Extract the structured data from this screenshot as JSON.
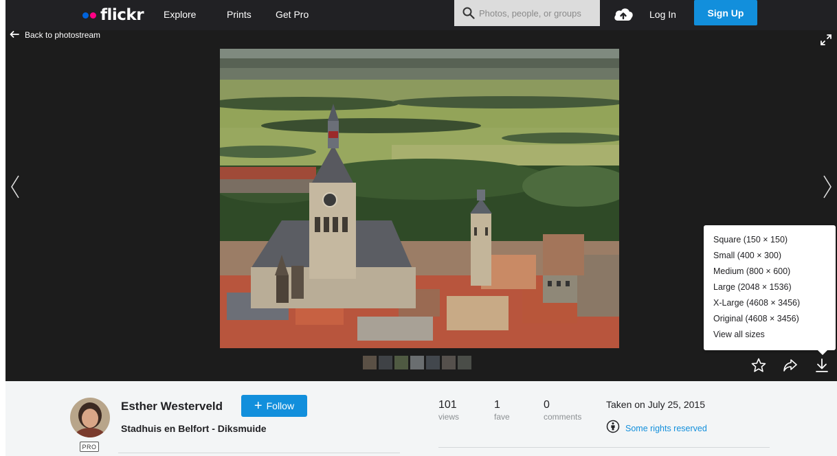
{
  "header": {
    "logo_text": "flickr",
    "logo_dot_colors": [
      "#0063dc",
      "#ff0084"
    ],
    "nav": [
      "Explore",
      "Prints",
      "Get Pro"
    ],
    "search_placeholder": "Photos, people, or groups",
    "login": "Log In",
    "signup": "Sign Up",
    "accent": "#128fdc"
  },
  "viewer": {
    "back_label": "Back to photostream",
    "icons": {
      "back": "arrow-left-icon",
      "expand": "expand-icon",
      "prev": "chevron-left-icon",
      "next": "chevron-right-icon",
      "fave": "star-icon",
      "share": "share-icon",
      "download": "download-icon"
    },
    "photo_description": "aerial view of a town with a church tower and belfry, green fields behind",
    "filmstrip_count": 7
  },
  "download_menu": {
    "options": [
      "Square (150 × 150)",
      "Small (400 × 300)",
      "Medium (800 × 600)",
      "Large (2048 × 1536)",
      "X-Large (4608 × 3456)",
      "Original (4608 × 3456)",
      "View all sizes"
    ]
  },
  "info": {
    "author": "Esther Westerveld",
    "pro_badge": "PRO",
    "follow_label": "Follow",
    "title": "Stadhuis en Belfort - Diksmuide",
    "stats": [
      {
        "value": "101",
        "label": "views"
      },
      {
        "value": "1",
        "label": "fave"
      },
      {
        "value": "0",
        "label": "comments"
      }
    ],
    "taken": "Taken on July 25, 2015",
    "rights": "Some rights reserved"
  }
}
